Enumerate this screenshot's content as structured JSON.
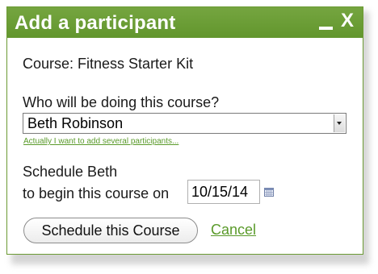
{
  "dialog": {
    "title": "Add a participant",
    "minimize_icon": "minimize-icon",
    "close_label": "X"
  },
  "course": {
    "line": "Course: Fitness Starter Kit"
  },
  "participant": {
    "question": "Who will be doing this course?",
    "selected": "Beth Robinson",
    "several_link": "Actually I want to add several participants..."
  },
  "schedule": {
    "line1": "Schedule Beth",
    "line2": "to begin this course on",
    "date_value": "10/15/14",
    "calendar_icon": "calendar-icon"
  },
  "actions": {
    "schedule_label": "Schedule this Course",
    "cancel_label": "Cancel"
  },
  "colors": {
    "accent": "#6a9d35",
    "link": "#5a9a2a"
  }
}
